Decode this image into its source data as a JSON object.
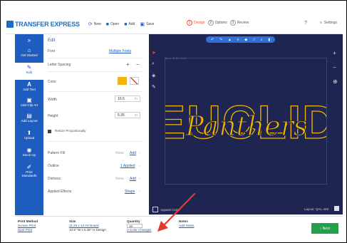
{
  "brand": {
    "name": "TRANSFER EXPRESS"
  },
  "toolbar": {
    "items": [
      {
        "label": "New",
        "icon": "refresh-icon"
      },
      {
        "label": "Open",
        "icon": "folder-icon"
      },
      {
        "label": "Add",
        "icon": "folder-plus-icon"
      },
      {
        "label": "Save",
        "icon": "save-icon"
      }
    ],
    "steps": [
      {
        "num": "1",
        "label": "Design"
      },
      {
        "num": "2",
        "label": "Options"
      },
      {
        "num": "3",
        "label": "Review"
      }
    ],
    "help": "?",
    "settings": "Settings"
  },
  "sidebar": {
    "items": [
      {
        "label": "Get Started",
        "icon": "home-icon"
      },
      {
        "label": "Edit",
        "icon": "pencil-icon"
      },
      {
        "label": "Add Text",
        "icon": "text-icon"
      },
      {
        "label": "Add Clip Art",
        "icon": "image-icon"
      },
      {
        "label": "Add Layout",
        "icon": "layout-icon"
      },
      {
        "label": "Upload",
        "icon": "upload-icon"
      },
      {
        "label": "Mock Up",
        "icon": "eye-icon"
      },
      {
        "label": "Print Standards",
        "icon": "pen-icon"
      }
    ]
  },
  "edit": {
    "title": "Edit",
    "font_label": "Font",
    "font_value": "Multiple Fonts",
    "letter_spacing_label": "Letter Spacing",
    "color_label": "Color",
    "width_label": "Width",
    "width_value": "10.5",
    "width_unit": "in",
    "height_label": "Height",
    "height_value": "5.35",
    "height_unit": "in",
    "resize_label": "Resize Proportionally",
    "pattern_fill_label": "Pattern Fill",
    "pattern_fill_value": "None",
    "pattern_fill_action": "Add",
    "outline_label": "Outline",
    "outline_value": "1 Applied",
    "distress_label": "Distress",
    "distress_value": "None",
    "distress_action": "Add",
    "applied_effects_label": "Applied Effects",
    "applied_effects_value": "Shape"
  },
  "canvas": {
    "size_text": "Sheet: 11.25 x 14.5",
    "word_outline": "EUCLID",
    "word_script": "Panthers",
    "apparel_label": "Apparel Color",
    "layout_id": "Layout: QAL-448"
  },
  "colors": {
    "sidebar": "#1e5cbf",
    "canvas": "#1d2550",
    "design_gold": "#f5b400",
    "next_green": "#24a04a",
    "step_active": "#e8512e"
  },
  "bottom": {
    "print_method_head": "Print Method",
    "print_method_value": "Screen Print",
    "print_method_link": "Spot Print",
    "size_head": "Size",
    "size_value": "11.25 x 14 Art Board",
    "size_detail": "10.5\" W x 5.35\" H Design",
    "quantity_head": "Quantity",
    "quantity_value": "10",
    "quantity_link": "3 Color Changes",
    "notes_head": "Notes",
    "notes_link": "Add Notes",
    "next_label": "Next"
  }
}
